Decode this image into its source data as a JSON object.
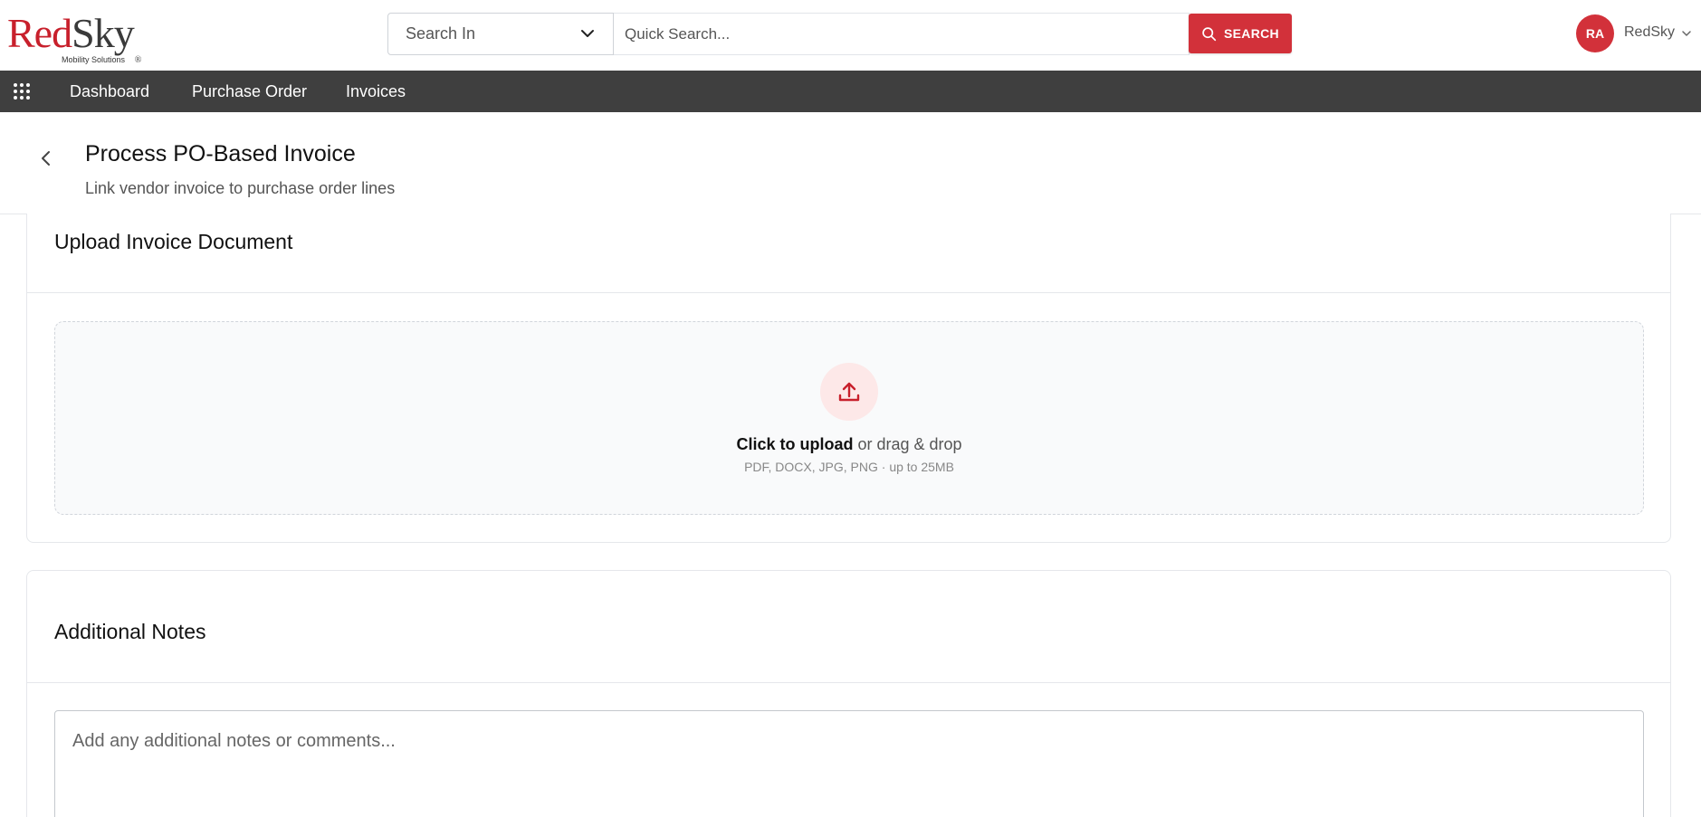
{
  "header": {
    "logo": {
      "red": "Red",
      "dark": "Sky",
      "reg": "®",
      "tagline": "Mobility Solutions"
    },
    "search_in": {
      "label": "Search In",
      "icon": "chevron-down-icon"
    },
    "quick_search": {
      "placeholder": "Quick Search..."
    },
    "search_button": {
      "label": "SEARCH",
      "icon": "search-icon"
    },
    "user": {
      "initials": "RA",
      "name": "RedSky",
      "icon": "chevron-down-icon"
    }
  },
  "nav": {
    "menu_icon": "grid-icon",
    "items": [
      {
        "label": "Dashboard"
      },
      {
        "label": "Purchase Order"
      },
      {
        "label": "Invoices"
      }
    ]
  },
  "page": {
    "back_icon": "chevron-left-icon",
    "title": "Process PO-Based Invoice",
    "subtitle": "Link vendor invoice to purchase order lines"
  },
  "upload_card": {
    "title": "Upload Invoice Document",
    "icon": "upload-icon",
    "click_text": "Click to upload",
    "drag_text": " or drag & drop",
    "hint": "PDF, DOCX, JPG, PNG · up to 25MB"
  },
  "notes_card": {
    "title": "Additional Notes",
    "placeholder": "Add any additional notes or comments..."
  },
  "colors": {
    "brand_red": "#d2313a",
    "nav_bg": "#3f3f3f",
    "upload_circle": "#fde8e8"
  }
}
